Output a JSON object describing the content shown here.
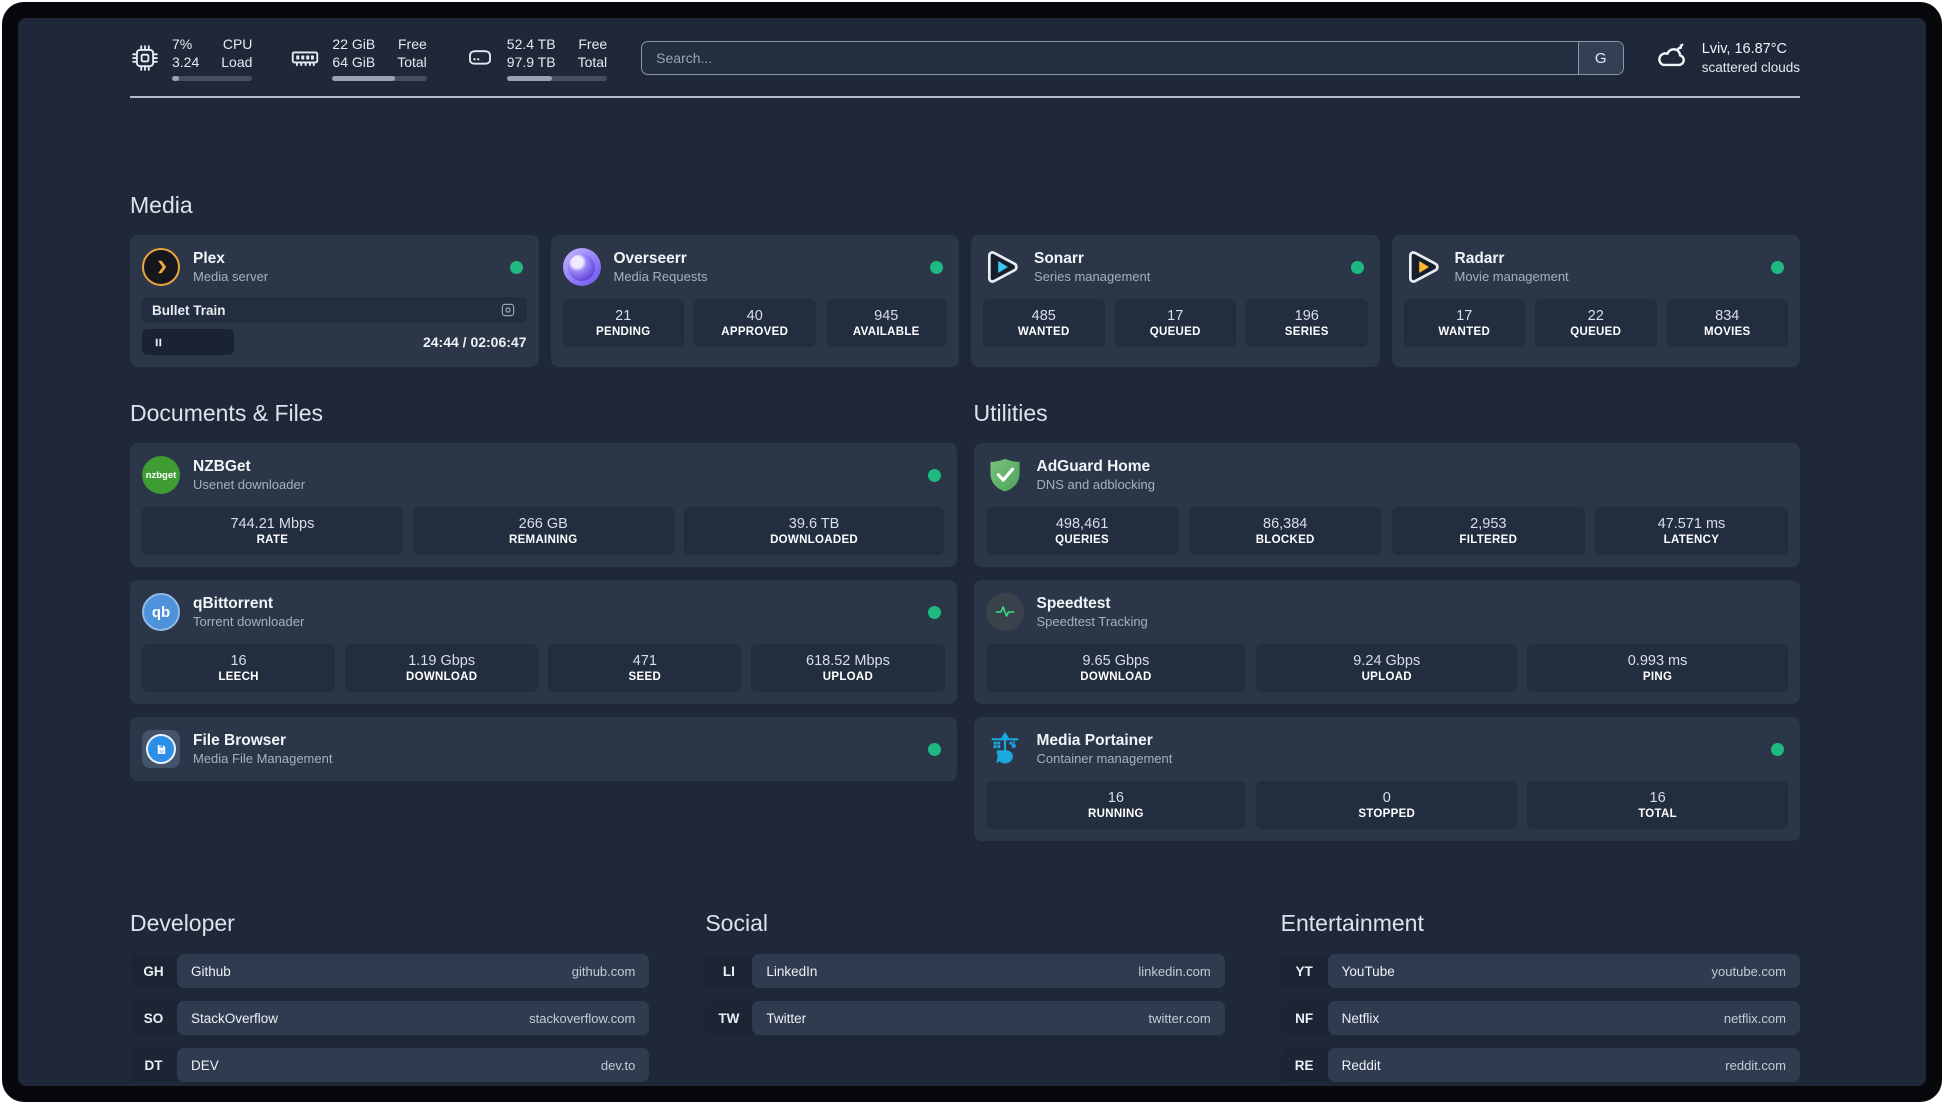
{
  "colors": {
    "status_online": "#1db981",
    "page_background": "#1e2838",
    "card_background": "#2b3648"
  },
  "header": {
    "system_stats": [
      {
        "icon": "cpu-icon",
        "values": [
          "7%",
          "3.24"
        ],
        "labels": [
          "CPU",
          "Load"
        ],
        "progress_percent": 9
      },
      {
        "icon": "memory-icon",
        "values": [
          "22 GiB",
          "64 GiB"
        ],
        "labels": [
          "Free",
          "Total"
        ],
        "progress_percent": 66
      },
      {
        "icon": "disk-icon",
        "values": [
          "52.4 TB",
          "97.9 TB"
        ],
        "labels": [
          "Free",
          "Total"
        ],
        "progress_percent": 45
      }
    ],
    "search": {
      "placeholder": "Search...",
      "engine_button": "G"
    },
    "weather": {
      "location": "Lviv, 16.87°C",
      "condition": "scattered clouds"
    }
  },
  "media_section": {
    "title": "Media",
    "cards": [
      {
        "icon": "plex-icon",
        "name": "Plex",
        "subtitle": "Media server",
        "online": true,
        "player": {
          "title": "Bullet Train",
          "time": "24:44 / 02:06:47"
        }
      },
      {
        "icon": "overseerr-icon",
        "name": "Overseerr",
        "subtitle": "Media Requests",
        "online": true,
        "stats": [
          {
            "value": "21",
            "label": "PENDING"
          },
          {
            "value": "40",
            "label": "APPROVED"
          },
          {
            "value": "945",
            "label": "AVAILABLE"
          }
        ]
      },
      {
        "icon": "sonarr-icon",
        "name": "Sonarr",
        "subtitle": "Series management",
        "online": true,
        "stats": [
          {
            "value": "485",
            "label": "WANTED"
          },
          {
            "value": "17",
            "label": "QUEUED"
          },
          {
            "value": "196",
            "label": "SERIES"
          }
        ]
      },
      {
        "icon": "radarr-icon",
        "name": "Radarr",
        "subtitle": "Movie management",
        "online": true,
        "stats": [
          {
            "value": "17",
            "label": "WANTED"
          },
          {
            "value": "22",
            "label": "QUEUED"
          },
          {
            "value": "834",
            "label": "MOVIES"
          }
        ]
      }
    ]
  },
  "middle_sections": [
    {
      "title": "Documents & Files",
      "cards": [
        {
          "icon": "nzbget-icon",
          "name": "NZBGet",
          "subtitle": "Usenet downloader",
          "online": true,
          "stats": [
            {
              "value": "744.21 Mbps",
              "label": "RATE"
            },
            {
              "value": "266 GB",
              "label": "REMAINING"
            },
            {
              "value": "39.6 TB",
              "label": "DOWNLOADED"
            }
          ]
        },
        {
          "icon": "qbittorrent-icon",
          "name": "qBittorrent",
          "subtitle": "Torrent downloader",
          "online": true,
          "stats": [
            {
              "value": "16",
              "label": "LEECH"
            },
            {
              "value": "1.19 Gbps",
              "label": "DOWNLOAD"
            },
            {
              "value": "471",
              "label": "SEED"
            },
            {
              "value": "618.52 Mbps",
              "label": "UPLOAD"
            }
          ]
        },
        {
          "icon": "filebrowser-icon",
          "name": "File Browser",
          "subtitle": "Media File Management",
          "online": true
        }
      ]
    },
    {
      "title": "Utilities",
      "cards": [
        {
          "icon": "adguard-icon",
          "name": "AdGuard Home",
          "subtitle": "DNS and adblocking",
          "online": false,
          "stats": [
            {
              "value": "498,461",
              "label": "QUERIES"
            },
            {
              "value": "86,384",
              "label": "BLOCKED"
            },
            {
              "value": "2,953",
              "label": "FILTERED"
            },
            {
              "value": "47.571 ms",
              "label": "LATENCY"
            }
          ]
        },
        {
          "icon": "speedtest-icon",
          "name": "Speedtest",
          "subtitle": "Speedtest Tracking",
          "online": false,
          "stats": [
            {
              "value": "9.65 Gbps",
              "label": "DOWNLOAD"
            },
            {
              "value": "9.24 Gbps",
              "label": "UPLOAD"
            },
            {
              "value": "0.993 ms",
              "label": "PING"
            }
          ]
        },
        {
          "icon": "portainer-icon",
          "name": "Media Portainer",
          "subtitle": "Container management",
          "online": true,
          "stats": [
            {
              "value": "16",
              "label": "RUNNING"
            },
            {
              "value": "0",
              "label": "STOPPED"
            },
            {
              "value": "16",
              "label": "TOTAL"
            }
          ]
        }
      ]
    }
  ],
  "link_sections": [
    {
      "title": "Developer",
      "links": [
        {
          "abbr": "GH",
          "name": "Github",
          "url": "github.com"
        },
        {
          "abbr": "SO",
          "name": "StackOverflow",
          "url": "stackoverflow.com"
        },
        {
          "abbr": "DT",
          "name": "DEV",
          "url": "dev.to"
        }
      ]
    },
    {
      "title": "Social",
      "links": [
        {
          "abbr": "LI",
          "name": "LinkedIn",
          "url": "linkedin.com"
        },
        {
          "abbr": "TW",
          "name": "Twitter",
          "url": "twitter.com"
        }
      ]
    },
    {
      "title": "Entertainment",
      "links": [
        {
          "abbr": "YT",
          "name": "YouTube",
          "url": "youtube.com"
        },
        {
          "abbr": "NF",
          "name": "Netflix",
          "url": "netflix.com"
        },
        {
          "abbr": "RE",
          "name": "Reddit",
          "url": "reddit.com"
        }
      ]
    }
  ]
}
